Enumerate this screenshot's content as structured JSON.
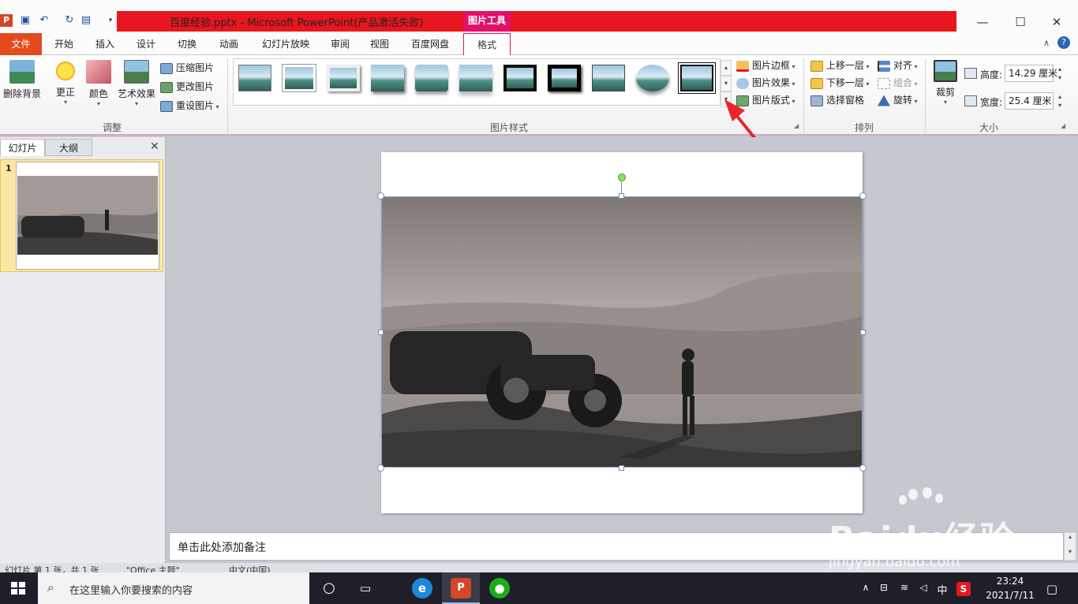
{
  "window": {
    "title": "百度经验.pptx - Microsoft PowerPoint(产品激活失败)",
    "context_tab_label": "图片工具",
    "minimize_label": "—",
    "maximize_label": "☐",
    "close_label": "✕"
  },
  "tabs": [
    {
      "label": "文件"
    },
    {
      "label": "开始"
    },
    {
      "label": "插入"
    },
    {
      "label": "设计"
    },
    {
      "label": "切换"
    },
    {
      "label": "动画"
    },
    {
      "label": "幻灯片放映"
    },
    {
      "label": "审阅"
    },
    {
      "label": "视图"
    },
    {
      "label": "百度网盘"
    },
    {
      "label": "格式"
    }
  ],
  "ribbon": {
    "adjust": {
      "group_label": "调整",
      "remove_bg": "删除背景",
      "corrections": "更正",
      "color": "颜色",
      "artistic": "艺术效果",
      "compress": "压缩图片",
      "change": "更改图片",
      "reset": "重设图片"
    },
    "styles": {
      "group_label": "图片样式",
      "border": "图片边框",
      "effects": "图片效果",
      "layout": "图片版式"
    },
    "arrange": {
      "group_label": "排列",
      "bring_forward": "上移一层",
      "send_backward": "下移一层",
      "selection_pane": "选择窗格",
      "align": "对齐",
      "group": "组合",
      "rotate": "旋转"
    },
    "size": {
      "group_label": "大小",
      "crop": "裁剪",
      "height_label": "高度:",
      "height_value": "14.29 厘米",
      "width_label": "宽度:",
      "width_value": "25.4 厘米"
    }
  },
  "panel": {
    "tab_slides": "幻灯片",
    "tab_outline": "大纲",
    "close": "✕",
    "slide_number": "1"
  },
  "notes": {
    "placeholder": "单击此处添加备注"
  },
  "statusbar": {
    "slide_info": "幻灯片 第 1 张，共 1 张",
    "theme": "\"Office 主题\"",
    "language": "中文(中国)"
  },
  "taskbar": {
    "search_placeholder": "在这里输入你要搜索的内容",
    "ime": "中",
    "time": "23:24",
    "date": "2021/7/11"
  },
  "watermark": {
    "brand": "Baidu经验",
    "url": "jingyan.baidu.com"
  },
  "colors": {
    "title_red": "#e8161f",
    "context_pink": "#e2106a",
    "file_tab_orange": "#e34b1c",
    "arrow_red": "#e8262b"
  }
}
